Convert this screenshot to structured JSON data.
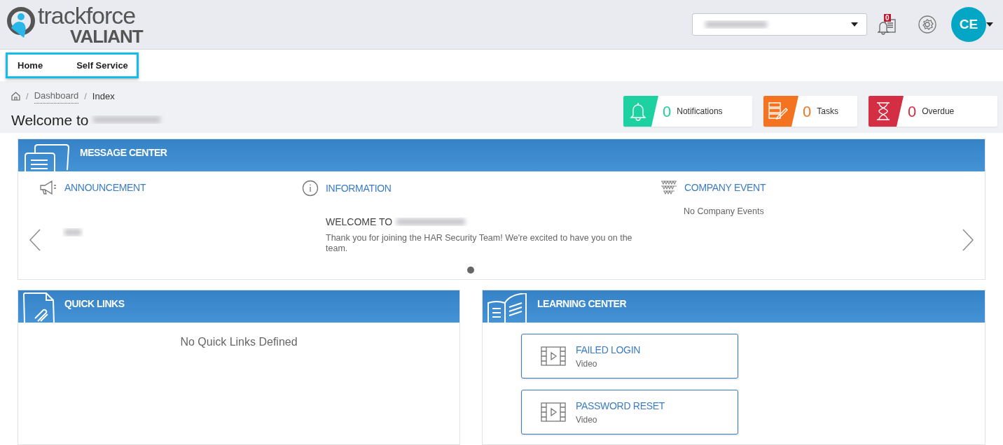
{
  "logo": {
    "line_1": "trackforce",
    "line_2": "VALIANT"
  },
  "header": {
    "notification_count": "0",
    "avatar_initials": "CE"
  },
  "nav": {
    "items": [
      {
        "label": "Home",
        "selected": false
      },
      {
        "label": "Self Service",
        "selected": false
      }
    ]
  },
  "breadcrumb": [
    {
      "separator": "/",
      "label": "Dashboard",
      "kind": "link"
    },
    {
      "separator": "/",
      "label": "Index",
      "kind": "current"
    }
  ],
  "page_title": "Welcome to",
  "stats": [
    {
      "kind": "bell",
      "count": "0",
      "label": "Notifications",
      "color": "#1dd1a1"
    },
    {
      "kind": "tasks",
      "count": "0",
      "label": "Tasks",
      "color": "#f47321"
    },
    {
      "kind": "hourglass",
      "count": "0",
      "label": "Overdue",
      "color": "#d42e45"
    }
  ],
  "message_center": {
    "title": "MESSAGE CENTER",
    "columns": [
      {
        "kind": "announcement",
        "heading": "ANNOUNCEMENT"
      },
      {
        "kind": "information",
        "heading": "INFORMATION",
        "title": "WELCOME TO",
        "body": "Thank you for joining the HAR Security Team! We're excited to have you on the team."
      },
      {
        "kind": "event",
        "heading": "COMPANY EVENT",
        "body": "No Company Events"
      }
    ]
  },
  "quick_links": {
    "title": "QUICK LINKS",
    "empty_text": "No Quick Links Defined"
  },
  "learning_center": {
    "title": "LEARNING CENTER",
    "items": [
      {
        "title": "FAILED LOGIN",
        "type": "Video"
      },
      {
        "title": "PASSWORD RESET",
        "type": "Video"
      }
    ]
  }
}
